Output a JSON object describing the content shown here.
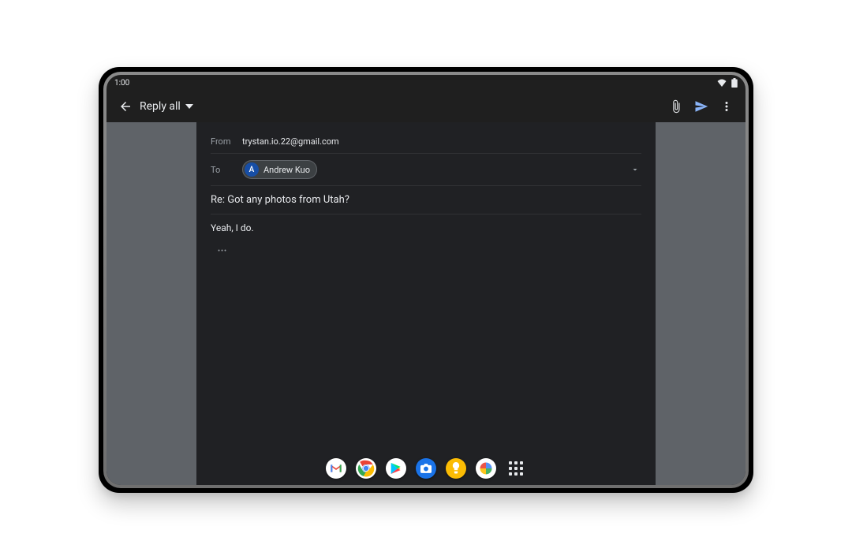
{
  "status": {
    "time": "1:00"
  },
  "appbar": {
    "title": "Reply all"
  },
  "compose": {
    "from_label": "From",
    "from_value": "trystan.io.22@gmail.com",
    "to_label": "To",
    "recipient": {
      "initial": "A",
      "name": "Andrew Kuo"
    },
    "subject": "Re: Got any photos from Utah?",
    "body": "Yeah, I do.",
    "quoted_toggle": "•••"
  },
  "dock": {
    "items": [
      "gmail",
      "chrome",
      "play-store",
      "camera",
      "keep",
      "photos",
      "all-apps"
    ]
  }
}
